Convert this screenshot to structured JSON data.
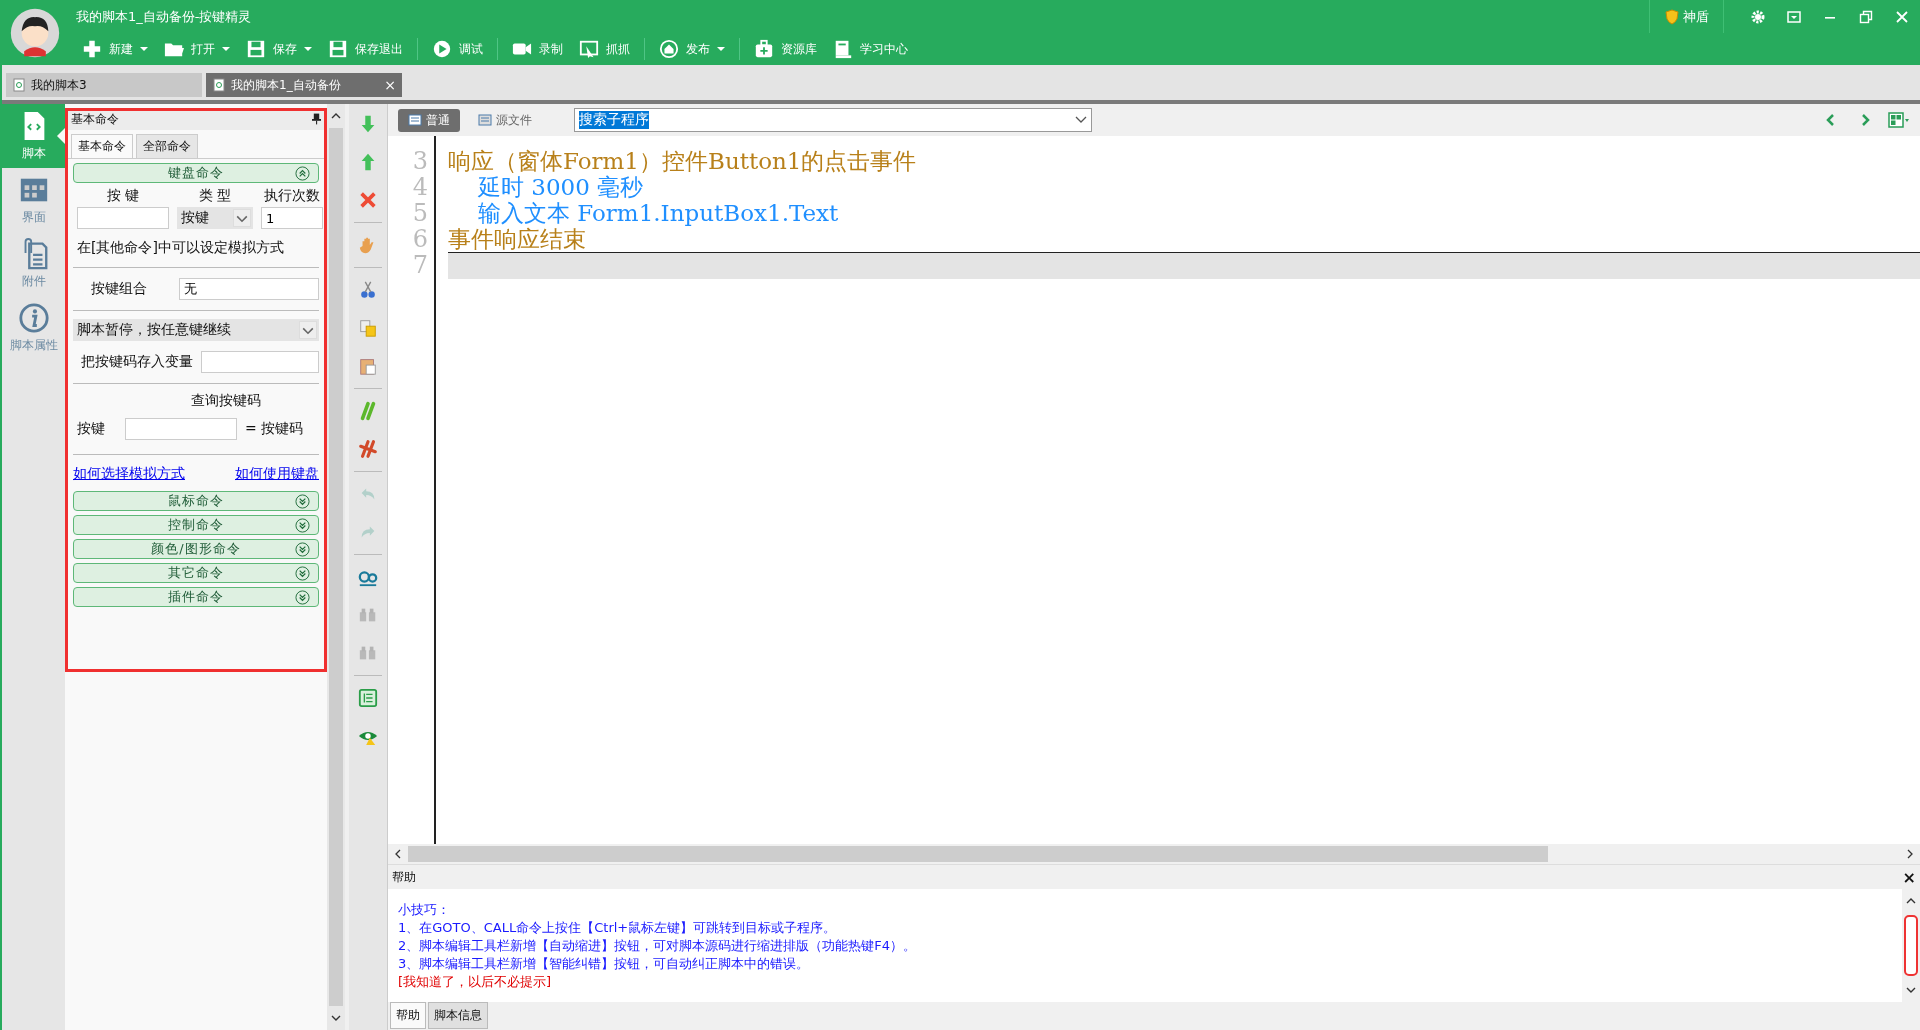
{
  "window": {
    "title": "我的脚本1_自动备份-按键精灵",
    "shield": "神盾"
  },
  "toolbar": [
    {
      "label": "新建",
      "dropdown": true
    },
    {
      "label": "打开",
      "dropdown": true
    },
    {
      "label": "保存",
      "dropdown": true
    },
    {
      "label": "保存退出",
      "dropdown": false
    },
    {
      "label": "调试",
      "dropdown": false
    },
    {
      "label": "录制",
      "dropdown": false
    },
    {
      "label": "抓抓",
      "dropdown": false
    },
    {
      "label": "发布",
      "dropdown": true
    },
    {
      "label": "资源库",
      "dropdown": false
    },
    {
      "label": "学习中心",
      "dropdown": false
    }
  ],
  "doc_tabs": [
    {
      "label": "我的脚本3",
      "selected": false,
      "closable": false
    },
    {
      "label": "我的脚本1_自动备份",
      "selected": true,
      "closable": true
    }
  ],
  "close_glyph": "×",
  "nav": [
    {
      "label": "脚本",
      "selected": true
    },
    {
      "label": "界面",
      "selected": false
    },
    {
      "label": "附件",
      "selected": false
    },
    {
      "label": "脚本属性",
      "selected": false
    }
  ],
  "panel": {
    "title": "基本命令",
    "tabs": [
      {
        "label": "基本命令",
        "selected": true
      },
      {
        "label": "全部命令",
        "selected": false
      }
    ],
    "keyboard": {
      "title": "键盘命令",
      "expanded": true,
      "col_key": "按 键",
      "col_type": "类 型",
      "col_count": "执行次数",
      "type_value": "按键",
      "count_value": "1",
      "note": "在[其他命令]中可以设定模拟方式",
      "combo_label": "按键组合",
      "combo_value": "无",
      "pause_option": "脚本暂停，按任意键继续",
      "store_label": "把按键码存入变量",
      "query_title": "查询按键码",
      "query_label": "按键",
      "query_result": "= 按键码",
      "links": [
        "如何选择模拟方式",
        "如何使用键盘"
      ]
    },
    "sections": [
      {
        "title": "鼠标命令",
        "expanded": false
      },
      {
        "title": "控制命令",
        "expanded": false
      },
      {
        "title": "颜色/图形命令",
        "expanded": false
      },
      {
        "title": "其它命令",
        "expanded": false
      },
      {
        "title": "插件命令",
        "expanded": false
      }
    ]
  },
  "tool_groups": [
    [
      {
        "disabled": false
      },
      {
        "disabled": false
      },
      {
        "disabled": false
      }
    ],
    [
      {
        "disabled": false
      }
    ],
    [
      {
        "disabled": false
      },
      {
        "disabled": false
      },
      {
        "disabled": false
      }
    ],
    [
      {
        "disabled": false
      },
      {
        "disabled": false
      }
    ],
    [
      {
        "disabled": true
      },
      {
        "disabled": true
      }
    ],
    [
      {
        "disabled": false
      },
      {
        "disabled": true
      },
      {
        "disabled": true
      }
    ],
    [
      {
        "disabled": false
      },
      {
        "disabled": false
      }
    ]
  ],
  "editor": {
    "modes": [
      {
        "label": "普通",
        "selected": true
      },
      {
        "label": "源文件",
        "selected": false
      }
    ],
    "search_value": "搜索子程序",
    "lines": [
      {
        "number": "3",
        "text": "响应（窗体Form1）控件Button1的点击事件",
        "kind": "event",
        "current": false
      },
      {
        "number": "4",
        "text": "延时 3000 毫秒",
        "kind": "command",
        "current": false
      },
      {
        "number": "5",
        "text": "输入文本 Form1.InputBox1.Text",
        "kind": "command",
        "current": false
      },
      {
        "number": "6",
        "text": "事件响应结束",
        "kind": "event",
        "current": false
      },
      {
        "number": "7",
        "kind": "command",
        "current": true
      }
    ]
  },
  "help": {
    "title": "帮助",
    "lines": [
      {
        "text": "小技巧：",
        "kind": "tip"
      },
      {
        "text": "1、在GOTO、CALL命令上按住【Ctrl+鼠标左键】可跳转到目标或子程序。",
        "kind": "tip"
      },
      {
        "text": "2、脚本编辑工具栏新增【自动缩进】按钮，可对脚本源码进行缩进排版（功能热键F4）。",
        "kind": "tip"
      },
      {
        "text": "3、脚本编辑工具栏新增【智能纠错】按钮，可自动纠正脚本中的错误。",
        "kind": "tip"
      },
      {
        "text": "[我知道了，以后不必提示]",
        "kind": "dismiss"
      }
    ],
    "tabs": [
      {
        "label": "帮助",
        "selected": true
      },
      {
        "label": "脚本信息",
        "selected": false
      }
    ]
  }
}
